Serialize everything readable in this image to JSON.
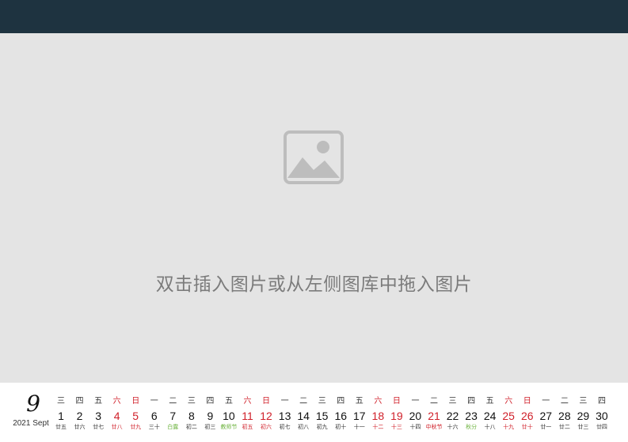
{
  "placeholder": {
    "icon": "image-placeholder-icon",
    "text": "双击插入图片或从左侧图库中拖入图片"
  },
  "calendar": {
    "month_number": "9",
    "month_caption": "2021 Sept",
    "colors": {
      "weekend": "#d0202a",
      "solar_term": "#6db33f",
      "header_bar": "#1e3340",
      "photo_bg": "#e4e4e4"
    },
    "days": [
      {
        "weekday": "三",
        "day": "1",
        "lunar": "廿五",
        "weekend": false,
        "type": "normal"
      },
      {
        "weekday": "四",
        "day": "2",
        "lunar": "廿六",
        "weekend": false,
        "type": "normal"
      },
      {
        "weekday": "五",
        "day": "3",
        "lunar": "廿七",
        "weekend": false,
        "type": "normal"
      },
      {
        "weekday": "六",
        "day": "4",
        "lunar": "廿八",
        "weekend": true,
        "type": "normal"
      },
      {
        "weekday": "日",
        "day": "5",
        "lunar": "廿九",
        "weekend": true,
        "type": "normal"
      },
      {
        "weekday": "一",
        "day": "6",
        "lunar": "三十",
        "weekend": false,
        "type": "normal"
      },
      {
        "weekday": "二",
        "day": "7",
        "lunar": "白露",
        "weekend": false,
        "type": "solar_term"
      },
      {
        "weekday": "三",
        "day": "8",
        "lunar": "初二",
        "weekend": false,
        "type": "normal"
      },
      {
        "weekday": "四",
        "day": "9",
        "lunar": "初三",
        "weekend": false,
        "type": "normal"
      },
      {
        "weekday": "五",
        "day": "10",
        "lunar": "教师节",
        "weekend": false,
        "type": "solar_term"
      },
      {
        "weekday": "六",
        "day": "11",
        "lunar": "初五",
        "weekend": true,
        "type": "normal"
      },
      {
        "weekday": "日",
        "day": "12",
        "lunar": "初六",
        "weekend": true,
        "type": "normal"
      },
      {
        "weekday": "一",
        "day": "13",
        "lunar": "初七",
        "weekend": false,
        "type": "normal"
      },
      {
        "weekday": "二",
        "day": "14",
        "lunar": "初八",
        "weekend": false,
        "type": "normal"
      },
      {
        "weekday": "三",
        "day": "15",
        "lunar": "初九",
        "weekend": false,
        "type": "normal"
      },
      {
        "weekday": "四",
        "day": "16",
        "lunar": "初十",
        "weekend": false,
        "type": "normal"
      },
      {
        "weekday": "五",
        "day": "17",
        "lunar": "十一",
        "weekend": false,
        "type": "normal"
      },
      {
        "weekday": "六",
        "day": "18",
        "lunar": "十二",
        "weekend": true,
        "type": "normal"
      },
      {
        "weekday": "日",
        "day": "19",
        "lunar": "十三",
        "weekend": true,
        "type": "normal"
      },
      {
        "weekday": "一",
        "day": "20",
        "lunar": "十四",
        "weekend": false,
        "type": "normal"
      },
      {
        "weekday": "二",
        "day": "21",
        "lunar": "中秋节",
        "weekend": false,
        "type": "festival"
      },
      {
        "weekday": "三",
        "day": "22",
        "lunar": "十六",
        "weekend": false,
        "type": "normal"
      },
      {
        "weekday": "四",
        "day": "23",
        "lunar": "秋分",
        "weekend": false,
        "type": "solar_term"
      },
      {
        "weekday": "五",
        "day": "24",
        "lunar": "十八",
        "weekend": false,
        "type": "normal"
      },
      {
        "weekday": "六",
        "day": "25",
        "lunar": "十九",
        "weekend": true,
        "type": "normal"
      },
      {
        "weekday": "日",
        "day": "26",
        "lunar": "廿十",
        "weekend": true,
        "type": "normal"
      },
      {
        "weekday": "一",
        "day": "27",
        "lunar": "廿一",
        "weekend": false,
        "type": "normal"
      },
      {
        "weekday": "二",
        "day": "28",
        "lunar": "廿二",
        "weekend": false,
        "type": "normal"
      },
      {
        "weekday": "三",
        "day": "29",
        "lunar": "廿三",
        "weekend": false,
        "type": "normal"
      },
      {
        "weekday": "四",
        "day": "30",
        "lunar": "廿四",
        "weekend": false,
        "type": "normal"
      }
    ]
  }
}
